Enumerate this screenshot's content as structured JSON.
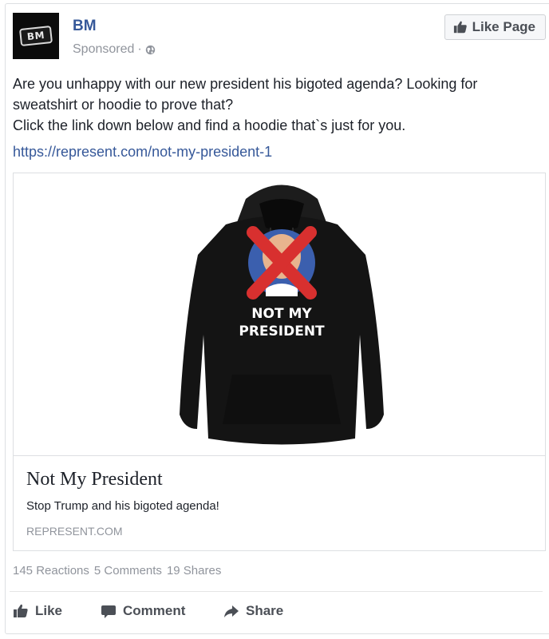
{
  "post": {
    "page_name": "BM",
    "avatar_text": "BM",
    "sponsored": "Sponsored",
    "meta_separator": "·",
    "like_page_label": "Like Page",
    "text_lines": [
      "Are you unhappy with our new president his bigoted agenda? Looking for",
      "sweatshirt or hoodie to prove that?",
      "Click the link down below and find a hoodie that`s just for you."
    ],
    "link": "https://represent.com/not-my-president-1"
  },
  "attachment": {
    "image_text_line1": "NOT MY",
    "image_text_line2": "PRESIDENT",
    "title": "Not My President",
    "description": "Stop Trump and his bigoted agenda!",
    "domain": "REPRESENT.COM"
  },
  "stats": {
    "reactions": "145 Reactions",
    "comments": "5 Comments",
    "shares": "19 Shares"
  },
  "actions": {
    "like": "Like",
    "comment": "Comment",
    "share": "Share"
  },
  "colors": {
    "link": "#365899",
    "muted": "#90949c",
    "text": "#1d2129",
    "button_text": "#4b4f56"
  },
  "icons": [
    "globe-icon",
    "thumbs-up-icon",
    "comment-icon",
    "share-icon"
  ]
}
